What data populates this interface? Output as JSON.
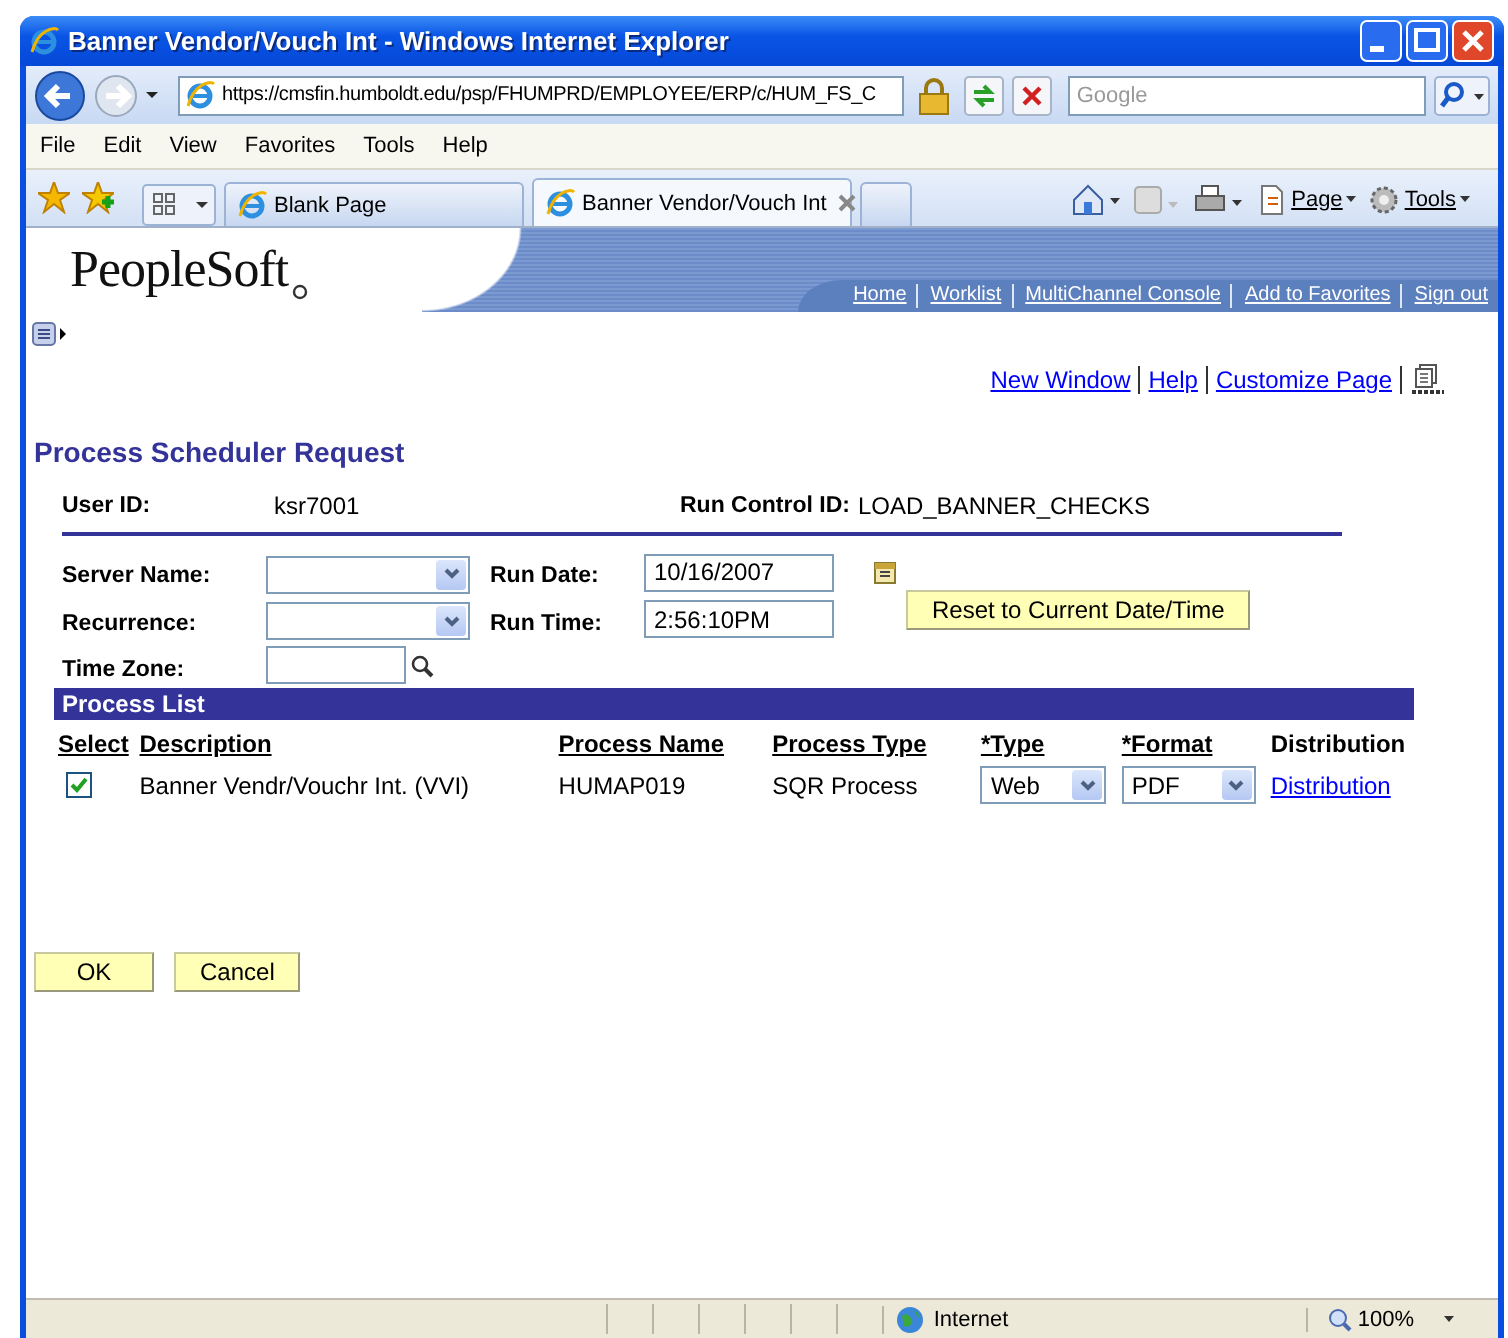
{
  "window": {
    "title": "Banner Vendor/Vouch Int - Windows Internet Explorer"
  },
  "address_bar": {
    "url": "https://cmsfin.humboldt.edu/psp/FHUMPRD/EMPLOYEE/ERP/c/HUM_FS_C"
  },
  "search": {
    "placeholder": "Google"
  },
  "menu": [
    "File",
    "Edit",
    "View",
    "Favorites",
    "Tools",
    "Help"
  ],
  "tabs": [
    {
      "label": "Blank Page",
      "selected": false
    },
    {
      "label": "Banner Vendor/Vouch Int",
      "selected": true
    }
  ],
  "command_bar": [
    "Page",
    "Tools"
  ],
  "header": {
    "logo": "PeopleSoft",
    "links": [
      "Home",
      "Worklist",
      "MultiChannel Console",
      "Add to Favorites",
      "Sign out"
    ]
  },
  "page_links": [
    "New Window",
    "Help",
    "Customize Page"
  ],
  "page_title": "Process Scheduler Request",
  "user_id": {
    "label": "User ID:",
    "value": "ksr7001"
  },
  "run_control": {
    "label": "Run Control ID:",
    "value": "LOAD_BANNER_CHECKS"
  },
  "left_fields": [
    {
      "label": "Server Name:",
      "kind": "select"
    },
    {
      "label": "Recurrence:",
      "kind": "select"
    },
    {
      "label": "Time Zone:",
      "kind": "lookup"
    }
  ],
  "run_date": {
    "label": "Run Date:",
    "value": "10/16/2007"
  },
  "run_time": {
    "label": "Run Time:",
    "value": "2:56:10PM"
  },
  "reset_button": "Reset to Current Date/Time",
  "process_list": {
    "title": "Process List",
    "columns": [
      {
        "label": "Select",
        "sortable": true
      },
      {
        "label": "Description",
        "sortable": true
      },
      {
        "label": "Process Name",
        "sortable": true
      },
      {
        "label": "Process Type",
        "sortable": true
      },
      {
        "label": "*Type",
        "sortable": true
      },
      {
        "label": "*Format",
        "sortable": true
      },
      {
        "label": "Distribution",
        "sortable": false
      }
    ],
    "rows": [
      {
        "checked": true,
        "description": "Banner Vendr/Vouchr Int. (VVI)",
        "process_name": "HUMAP019",
        "process_type": "SQR Process",
        "type": "Web",
        "format": "PDF",
        "distribution": "Distribution"
      }
    ]
  },
  "buttons": [
    "OK",
    "Cancel"
  ],
  "status_bar": {
    "zone": "Internet",
    "zoom": "100%"
  }
}
